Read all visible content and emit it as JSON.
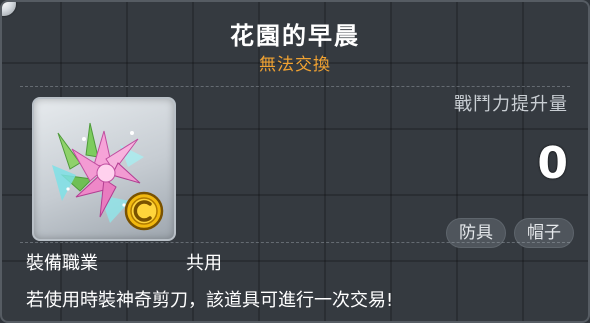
{
  "item": {
    "name": "花園的早晨",
    "trade_status": "無法交換",
    "icon": "crystal-flower-icon",
    "badge_icon": "gold-coin-c-icon"
  },
  "combat_power": {
    "label": "戰鬥力提升量",
    "value": "0"
  },
  "tags": [
    "防具",
    "帽子"
  ],
  "job": {
    "label": "裝備職業",
    "value": "共用"
  },
  "description": "若使用時裝神奇剪刀，該道具可進行一次交易!",
  "colors": {
    "trade_status": "#f0a232",
    "background": "#353a40",
    "tag_background": "#4f555c"
  }
}
